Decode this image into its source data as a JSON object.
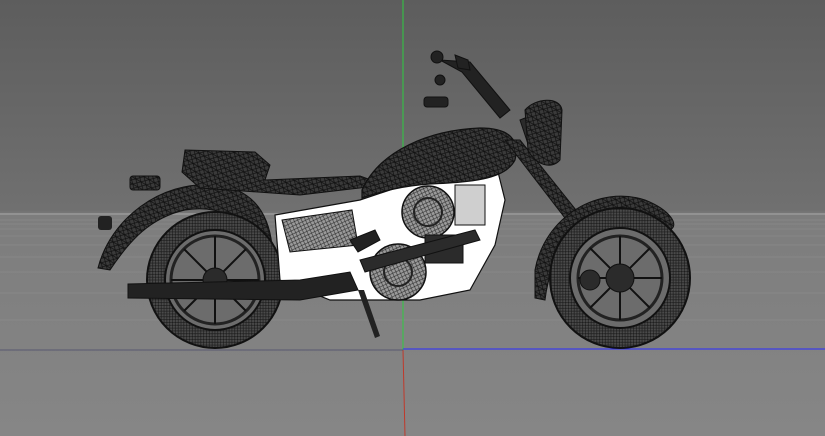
{
  "viewport": {
    "background_top": "#5d5d5d",
    "background_bottom": "#868686",
    "grid_color": "#8f8f8f",
    "axis_colors": {
      "x": "#2a2aff",
      "y": "#2ecc40",
      "z": "#c0392b"
    }
  },
  "model": {
    "name_icon": "motorcycle-wireframe",
    "wire_color": "#1a1a1a",
    "fill_light": "#ffffff",
    "fill_dark": "#2b2b2b"
  }
}
